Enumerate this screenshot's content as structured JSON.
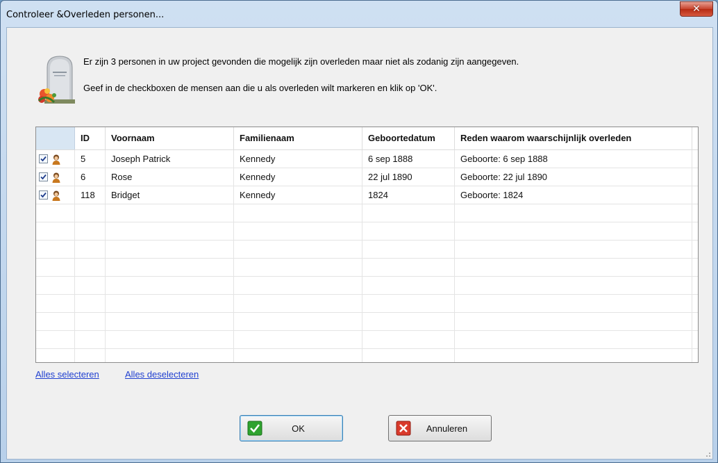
{
  "window": {
    "title": "Controleer &Overleden personen...",
    "close_glyph": "✕"
  },
  "messages": {
    "line1": "Er zijn 3 personen in uw project gevonden die mogelijk zijn overleden maar niet als zodanig zijn aangegeven.",
    "line2": "Geef in de checkboxen de mensen aan die u als overleden wilt markeren en klik op 'OK'."
  },
  "icons": {
    "header": "tombstone-with-flowers-icon",
    "row": "person-icon",
    "ok": "green-checkmark-icon",
    "cancel": "red-x-icon"
  },
  "table": {
    "headers": [
      "",
      "ID",
      "Voornaam",
      "Familienaam",
      "Geboortedatum",
      "Reden waarom waarschijnlijk overleden"
    ],
    "rows": [
      {
        "checked": true,
        "id": "5",
        "voornaam": "Joseph Patrick",
        "familienaam": "Kennedy",
        "geboortedatum": "6 sep 1888",
        "reden": "Geboorte: 6 sep 1888"
      },
      {
        "checked": true,
        "id": "6",
        "voornaam": "Rose",
        "familienaam": "Kennedy",
        "geboortedatum": "22 jul 1890",
        "reden": "Geboorte: 22 jul 1890"
      },
      {
        "checked": true,
        "id": "118",
        "voornaam": "Bridget",
        "familienaam": "Kennedy",
        "geboortedatum": "1824",
        "reden": "Geboorte: 1824"
      }
    ]
  },
  "links": {
    "select_all": "Alles selecteren",
    "deselect_all": "Alles deselecteren"
  },
  "buttons": {
    "ok": "OK",
    "cancel": "Annuleren"
  },
  "colors": {
    "link": "#1f3fd0",
    "close": "#c7432d",
    "ok_icon": "#2fa32f",
    "cancel_icon": "#d93a2b"
  }
}
